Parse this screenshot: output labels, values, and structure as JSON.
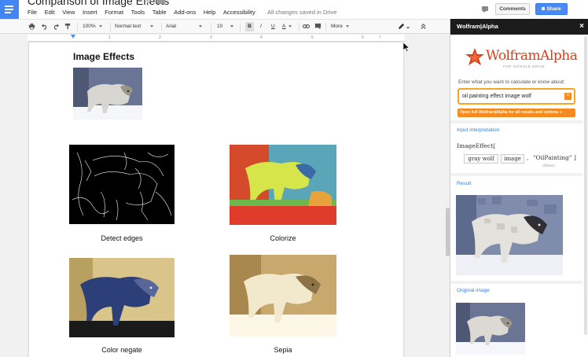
{
  "header": {
    "doc_title": "Comparison of Image Effects",
    "menu": [
      "File",
      "Edit",
      "View",
      "Insert",
      "Format",
      "Tools",
      "Table",
      "Add-ons",
      "Help",
      "Accessibility"
    ],
    "save_status": "All changes saved in Drive",
    "comments_label": "Comments",
    "share_label": "Share"
  },
  "toolbar": {
    "zoom": "100%",
    "style": "Normal text",
    "font": "Arial",
    "size": "10",
    "bold": "B",
    "italic": "I",
    "underline": "U",
    "text_color": "A",
    "more": "More"
  },
  "ruler": {
    "numbers": [
      "1",
      "2",
      "3",
      "4",
      "5",
      "6",
      "7"
    ]
  },
  "document": {
    "heading": "Image Effects",
    "captions": {
      "edges": "Detect edges",
      "colorize": "Colorize",
      "negate": "Color negate",
      "sepia": "Sepia"
    }
  },
  "sidebar": {
    "title": "Wolfram|Alpha",
    "close": "×",
    "logo_name": "WolframAlpha",
    "logo_sub": "FOR GOOGLE DRIVE",
    "prompt": "Enter what you want to calculate or know about:",
    "query": "oil painting effect image wolf",
    "equal_icon": "=",
    "open_full": "Open full Wolfram|Alpha for all results and options »",
    "input_interpretation_label": "Input interpretation",
    "interp_func": "ImageEffect[",
    "interp_arg1": "gray wolf",
    "interp_arg2": "image",
    "interp_comma": ",",
    "interp_arg3": "\"OilPainting\"",
    "interp_close": "]",
    "interp_filter": "(filter)",
    "result_label": "Result",
    "original_label": "Original image"
  },
  "colors": {
    "accent_blue": "#4a8af4",
    "wolfram_orange": "#f58a1f",
    "wolfram_red": "#d9401a",
    "sidebar_header": "#1c1c1c"
  }
}
